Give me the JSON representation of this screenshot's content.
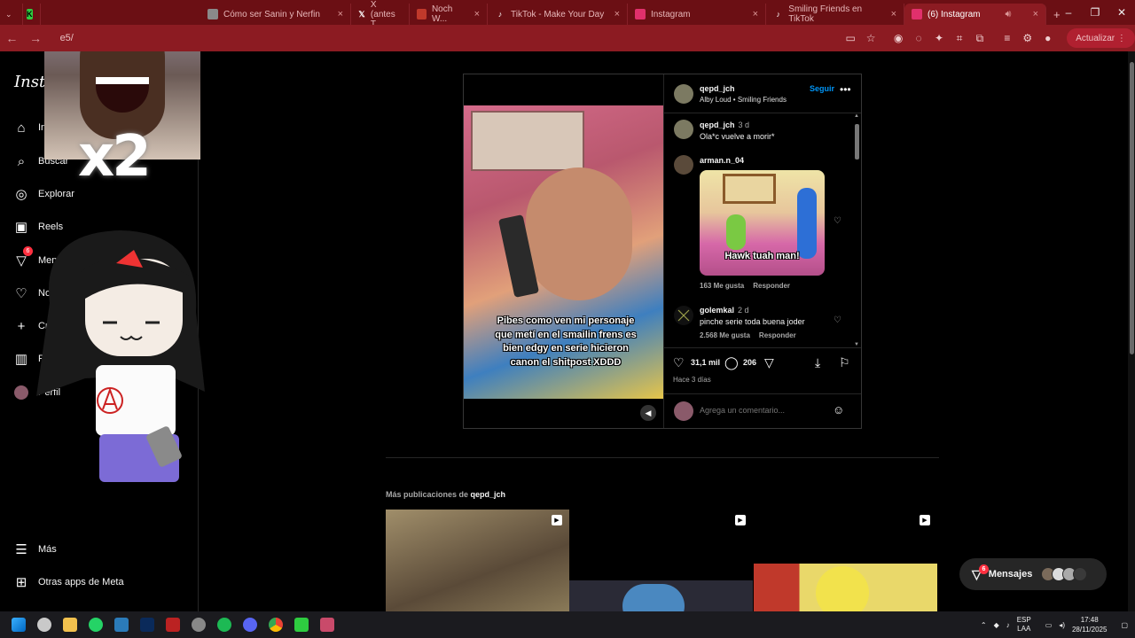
{
  "browser": {
    "tabs": [
      {
        "title": "",
        "icon": "k-icon",
        "color": "#2ecc40"
      },
      {
        "title": "Cómo ser Sanin y Nerfin",
        "icon": "tab-icon",
        "color": "#8a8a8a"
      },
      {
        "title": "X (antes T...",
        "icon": "x-icon",
        "color": "#000000"
      },
      {
        "title": "Noch W...",
        "icon": "tab-icon",
        "color": "#c0392b"
      },
      {
        "title": "TikTok - Make Your Day",
        "icon": "tiktok-icon",
        "color": "#000000"
      },
      {
        "title": "Instagram",
        "icon": "instagram-icon",
        "color": "#e1306c"
      },
      {
        "title": "Smiling Friends en TikTok",
        "icon": "tiktok-icon",
        "color": "#000000"
      },
      {
        "title": "(6) Instagram",
        "icon": "instagram-icon",
        "color": "#e1306c",
        "active": true
      }
    ],
    "url": "e5/",
    "profile_label": "Actualizar"
  },
  "sidebar": {
    "logo": "Instagram",
    "items": [
      {
        "label": "Inicio",
        "icon": "home-icon"
      },
      {
        "label": "Buscar",
        "icon": "search-icon"
      },
      {
        "label": "Explorar",
        "icon": "compass-icon"
      },
      {
        "label": "Reels",
        "icon": "reels-icon"
      },
      {
        "label": "Mensajes",
        "icon": "messenger-icon",
        "badge": "6"
      },
      {
        "label": "Notificaciones",
        "icon": "heart-icon"
      },
      {
        "label": "Crear",
        "icon": "plus-icon"
      },
      {
        "label": "Panel",
        "icon": "dashboard-icon"
      },
      {
        "label": "Perfil",
        "icon": "avatar-icon"
      }
    ],
    "more_label": "Más",
    "meta_label": "Otras apps de Meta"
  },
  "overlay": {
    "multiplier": "x2"
  },
  "post": {
    "video_caption": "Pibes como ven mi personaje que metí en el smailin frens es bien edgy en serie hicieron canon el shitpost XDDD",
    "author": "qepd_jch",
    "audio": "Alby Loud • Smiling Friends",
    "follow_label": "Seguir",
    "comments": [
      {
        "user": "qepd_jch",
        "time": "3 d",
        "text": "Ola*c vuelve a morir*"
      },
      {
        "user": "arman.n_04",
        "time": "",
        "text": "",
        "gif_text": "Hawk tuah man!",
        "likes": "163 Me gusta",
        "reply": "Responder"
      },
      {
        "user": "golemkal",
        "time": "2 d",
        "text": "pinche serie toda buena joder",
        "likes": "2.568 Me gusta",
        "reply": "Responder"
      }
    ],
    "like_count": "31,1 mil",
    "comment_count": "206",
    "posted_ago": "Hace 3 días",
    "comment_placeholder": "Agrega un comentario..."
  },
  "more_posts": {
    "prefix": "Más publicaciones de",
    "user": "qepd_jch"
  },
  "messages_pill": {
    "label": "Mensajes",
    "badge": "6"
  },
  "taskbar": {
    "lang": "ESP",
    "lang2": "LAA",
    "time": "17:48",
    "date": "28/11/2025"
  },
  "colors": {
    "browser_frame": "#6b0f14",
    "accent_blue": "#0095f6",
    "badge_red": "#ff3040"
  }
}
